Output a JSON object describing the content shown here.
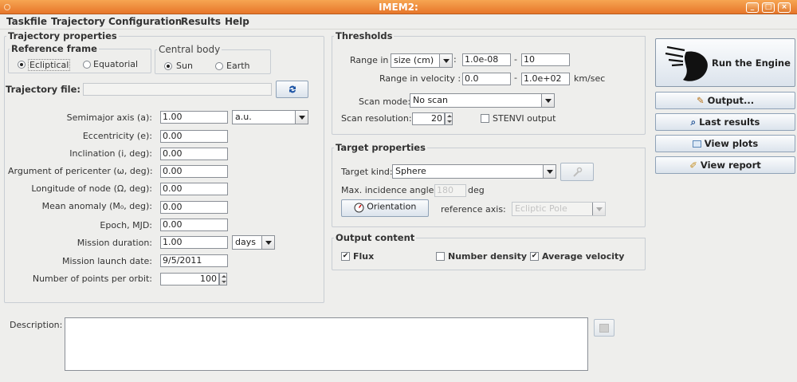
{
  "window": {
    "title": "IMEM2:",
    "controls": [
      "_",
      "□",
      "×"
    ]
  },
  "menu": [
    "Taskfile",
    "Trajectory",
    "Configuration",
    "Results",
    "Help"
  ],
  "trajectory": {
    "group_title": "Trajectory properties",
    "reference_frame": {
      "title": "Reference frame",
      "options": [
        "Ecliptical",
        "Equatorial"
      ],
      "selected": "Ecliptical"
    },
    "central_body": {
      "title": "Central body",
      "options": [
        "Sun",
        "Earth"
      ],
      "selected": "Sun"
    },
    "file_label": "Trajectory file:",
    "file_value": "",
    "fields": [
      {
        "label": "Semimajor axis (a):",
        "value": "1.00",
        "unit": "a.u."
      },
      {
        "label": "Eccentricity (e):",
        "value": "0.00"
      },
      {
        "label": "Inclination (i, deg):",
        "value": "0.00"
      },
      {
        "label": "Argument of pericenter (ω, deg):",
        "value": "0.00"
      },
      {
        "label": "Longitude of node (Ω, deg):",
        "value": "0.00"
      },
      {
        "label": "Mean anomaly (M₀, deg):",
        "value": "0.00"
      },
      {
        "label": "Epoch, MJD:",
        "value": "0.00"
      },
      {
        "label": "Mission duration:",
        "value": "1.00",
        "unit": "days"
      },
      {
        "label": "Mission launch date:",
        "value": "9/5/2011"
      },
      {
        "label": "Number of points per orbit:",
        "value": "100"
      }
    ]
  },
  "thresholds": {
    "title": "Thresholds",
    "range_in_label": "Range in",
    "range_in_select": "size (cm)",
    "range_colon": ":",
    "size_min": "1.0e-08",
    "size_max": "10",
    "dash": "-",
    "velocity_label": "Range in velocity :",
    "velocity_min": "0.0",
    "velocity_max": "1.0e+02",
    "velocity_unit": "km/sec",
    "scan_mode_label": "Scan mode:",
    "scan_mode": "No scan",
    "scan_resolution_label": "Scan resolution:",
    "scan_resolution": "20",
    "stenvi_label": "STENVI output",
    "stenvi_checked": false
  },
  "target": {
    "title": "Target properties",
    "kind_label": "Target kind:",
    "kind": "Sphere",
    "incidence_label": "Max. incidence angle :",
    "incidence_value": "180",
    "incidence_unit": "deg",
    "orientation_button": "Orientation",
    "reference_axis_label": "reference axis:",
    "reference_axis": "Ecliptic Pole"
  },
  "output": {
    "title": "Output content",
    "items": [
      {
        "label": "Flux",
        "checked": true
      },
      {
        "label": "Number density",
        "checked": false
      },
      {
        "label": "Average velocity",
        "checked": true
      }
    ]
  },
  "actions": {
    "run": "Run the Engine",
    "output": "Output...",
    "last_results": "Last results",
    "view_plots": "View plots",
    "view_report": "View report"
  },
  "description": {
    "label": "Description:",
    "value": ""
  },
  "colors": {
    "titlebar": "#e98a3a",
    "accent": "#1f56a6"
  }
}
